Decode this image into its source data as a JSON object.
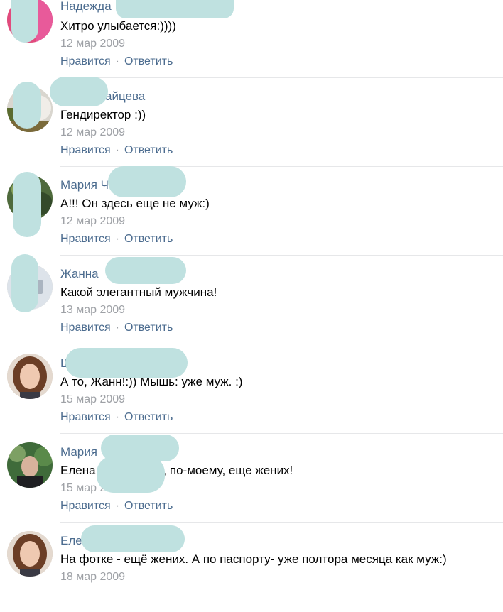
{
  "actions": {
    "like": "Нравится",
    "reply": "Ответить",
    "separator": "·"
  },
  "colors": {
    "link": "#4c6c8f",
    "date": "#9ea1a6",
    "text": "#000000",
    "divider": "#e6e7e9",
    "redaction": "#bfe1e0"
  },
  "comments": [
    {
      "author": "Надежда",
      "text": "Хитро улыбается:))))",
      "date": "12 мар 2009"
    },
    {
      "author": "айцева",
      "text": "Гендиректор :))",
      "date": "12 мар 2009"
    },
    {
      "author": "Мария Ч",
      "text": "А!!! Он здесь еще не муж:)",
      "date": "12 мар 2009"
    },
    {
      "author": "Жанна",
      "text": "Какой элегантный мужчина!",
      "date": "13 мар 2009"
    },
    {
      "author": "Ш",
      "text": "А то, Жанн!:)) Мышь: уже муж. :)",
      "date": "15 мар 2009"
    },
    {
      "author": "Мария",
      "text": "Елена          я, на фотке, по-моему, еще жених!",
      "date": "15 мар 2009"
    },
    {
      "author": "Еле",
      "text": "На фотке - ещё жених. А по паспорту- уже полтора месяца как муж:)",
      "date": "18 мар 2009"
    }
  ]
}
